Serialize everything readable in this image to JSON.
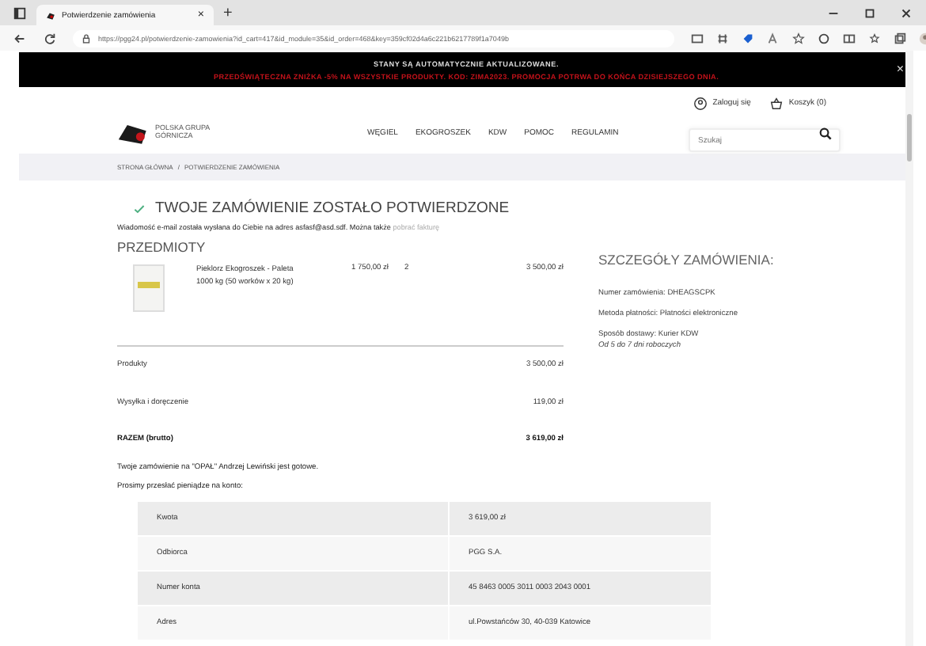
{
  "browser": {
    "tab_title": "Potwierdzenie zamówienia",
    "tab_close": "×",
    "new_tab": "+",
    "url": "https://pgg24.pl/potwierdzenie-zamowienia?id_cart=417&id_module=35&id_order=468&key=359cf02d4a6c221b6217789f1a7049b"
  },
  "banner": {
    "line_1": "STANY SĄ AUTOMATYCZNIE AKTUALIZOWANE.",
    "line_2": "PRZEDŚWIĄTECZNA ZNIŻKA -5% NA WSZYSTKIE PRODUKTY. KOD: ZIMA2023. PROMOCJA POTRWA DO KOŃCA DZISIEJSZEGO DNIA.",
    "close": "×"
  },
  "header": {
    "logo_text": "POLSKA GRUPA GÓRNICZA",
    "login": "Zaloguj się",
    "cart": "Koszyk (0)",
    "nav": [
      "WĘGIEL",
      "EKOGROSZEK",
      "KDW",
      "POMOC",
      "REGULAMIN"
    ],
    "search": {
      "placeholder": "Szukaj"
    }
  },
  "breadcrumb": [
    "STRONA GŁÓWNA",
    "/",
    "POTWIERDZENIE ZAMÓWIENIA"
  ],
  "confirmation": {
    "title": "TWOJE ZAMÓWIENIE ZOSTAŁO POTWIERDZONE",
    "message": "Wiadomość e-mail została wysłana do Ciebie na adres asfasf@asd.sdf. Można także",
    "invoice_link": "pobrać fakturę"
  },
  "items": {
    "heading": "PRZEDMIOTY",
    "products": [
      {
        "name": "Pieklorz Ekogroszek - Paleta 1000 kg (50 worków x 20 kg)",
        "price": "1 750,00 zł",
        "quantity": "2",
        "total": "3 500,00 zł"
      }
    ]
  },
  "summary": [
    {
      "label": "Produkty",
      "value": "3 500,00 zł",
      "bold": false
    },
    {
      "label": "Wysyłka i doręczenie",
      "value": "119,00 zł",
      "bold": false
    },
    {
      "label": "RAZEM (brutto)",
      "value": "3 619,00 zł",
      "bold": true
    }
  ],
  "payment_note": [
    "Twoje zamówienie na \"OPAŁ\" Andrzej Lewiński jest gotowe.",
    "Prosimy przesłać pieniądze na konto:"
  ],
  "payment_table": [
    {
      "label": "Kwota",
      "value": "3 619,00 zł"
    },
    {
      "label": "Odbiorca",
      "value": "PGG S.A."
    },
    {
      "label": "Numer konta",
      "value": "45 8463 0005 3011 0003 2043 0001"
    },
    {
      "label": "Adres",
      "value": "ul.Powstańców 30, 40-039 Katowice"
    }
  ],
  "order_details": {
    "heading": "SZCZEGÓŁY ZAMÓWIENIA:",
    "lines": [
      "Numer zamówienia: DHEAGSCPK",
      "Metoda płatności: Płatności elektroniczne",
      "Sposób dostawy: Kurier KDW"
    ],
    "delivery_time": "Od 5 do 7 dni roboczych"
  }
}
